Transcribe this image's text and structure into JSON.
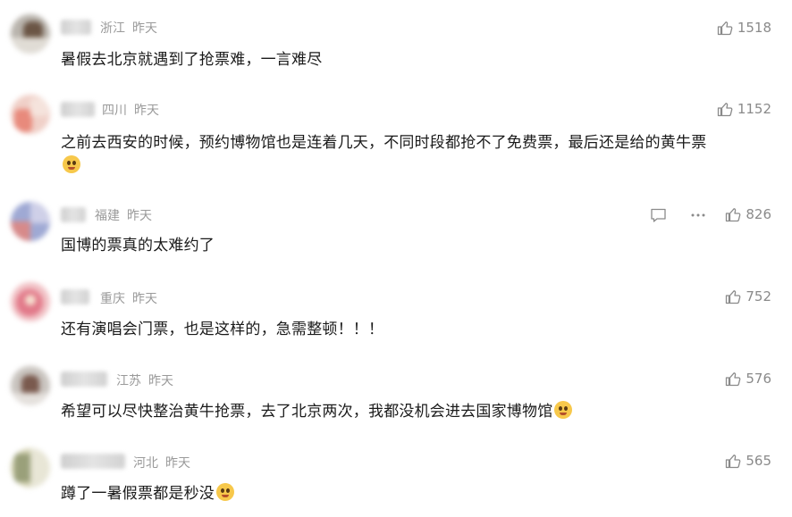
{
  "comments": [
    {
      "location": "浙江",
      "time": "昨天",
      "text": "暑假去北京就遇到了抢票难，一言难尽",
      "likes": "1518",
      "emoji": ""
    },
    {
      "location": "四川",
      "time": "昨天",
      "text": "之前去西安的时候，预约博物馆也是连着几天，不同时段都抢不了免费票，最后还是给的黄牛票",
      "likes": "1152",
      "emoji": "flushed-face"
    },
    {
      "location": "福建",
      "time": "昨天",
      "text": "国博的票真的太难约了",
      "likes": "826",
      "emoji": ""
    },
    {
      "location": "重庆",
      "time": "昨天",
      "text": "还有演唱会门票，也是这样的，急需整顿！！！",
      "likes": "752",
      "emoji": ""
    },
    {
      "location": "江苏",
      "time": "昨天",
      "text": "希望可以尽快整治黄牛抢票，去了北京两次，我都没机会进去国家博物馆",
      "likes": "576",
      "emoji": "crying-face"
    },
    {
      "location": "河北",
      "time": "昨天",
      "text": "蹲了一暑假票都是秒没",
      "likes": "565",
      "emoji": "crying-laughing-face"
    }
  ],
  "icons": {
    "like": "thumbs-up-icon",
    "reply": "comment-icon",
    "more": "more-icon"
  },
  "colors": {
    "meta": "#9a9a9a",
    "text": "#1a1a1a",
    "like": "#8a8a8a"
  }
}
